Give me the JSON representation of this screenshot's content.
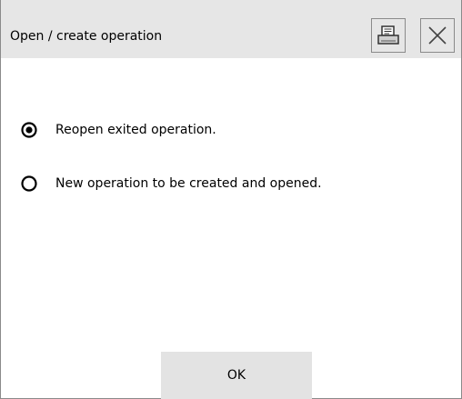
{
  "dialog": {
    "title": "Open / create operation",
    "header_icons": [
      "print-icon",
      "close-icon"
    ]
  },
  "options": [
    {
      "label": "Reopen exited operation.",
      "selected": true
    },
    {
      "label": "New operation to be created and opened.",
      "selected": false
    }
  ],
  "actions": {
    "ok_label": "OK"
  }
}
